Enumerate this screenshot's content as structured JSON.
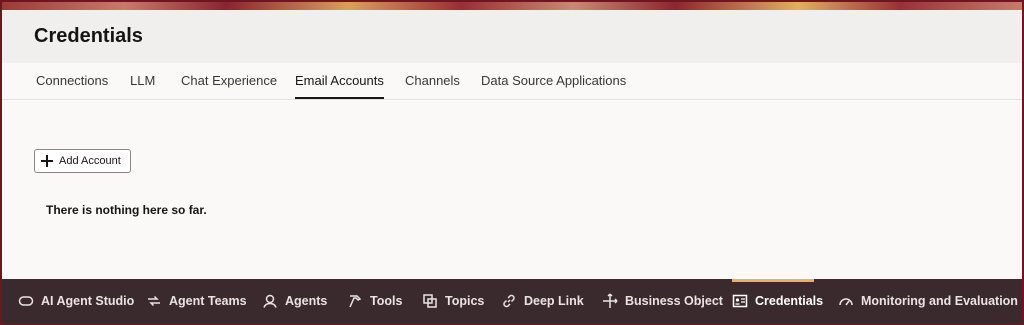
{
  "header": {
    "title": "Credentials"
  },
  "tabs": [
    {
      "label": "Connections"
    },
    {
      "label": "LLM"
    },
    {
      "label": "Chat Experience"
    },
    {
      "label": "Email Accounts",
      "active": true
    },
    {
      "label": "Channels"
    },
    {
      "label": "Data Source Applications"
    }
  ],
  "content": {
    "add_button_label": "Add Account",
    "empty_message": "There is nothing here so far."
  },
  "bottom_nav": [
    {
      "label": "AI Agent Studio",
      "icon": "ai-agent-studio-icon"
    },
    {
      "label": "Agent Teams",
      "icon": "agent-teams-icon"
    },
    {
      "label": "Agents",
      "icon": "agents-icon"
    },
    {
      "label": "Tools",
      "icon": "tools-icon"
    },
    {
      "label": "Topics",
      "icon": "topics-icon"
    },
    {
      "label": "Deep Link",
      "icon": "link-icon"
    },
    {
      "label": "Business Object",
      "icon": "business-object-icon"
    },
    {
      "label": "Credentials",
      "icon": "credentials-icon",
      "active": true
    },
    {
      "label": "Monitoring and Evaluation",
      "icon": "gauge-icon"
    }
  ],
  "colors": {
    "frame": "#6e1520",
    "header_bg": "#f1efed",
    "content_bg": "#fbf9f8",
    "nav_bg": "#3b2a2d",
    "active_indicator": "#e8b060"
  }
}
